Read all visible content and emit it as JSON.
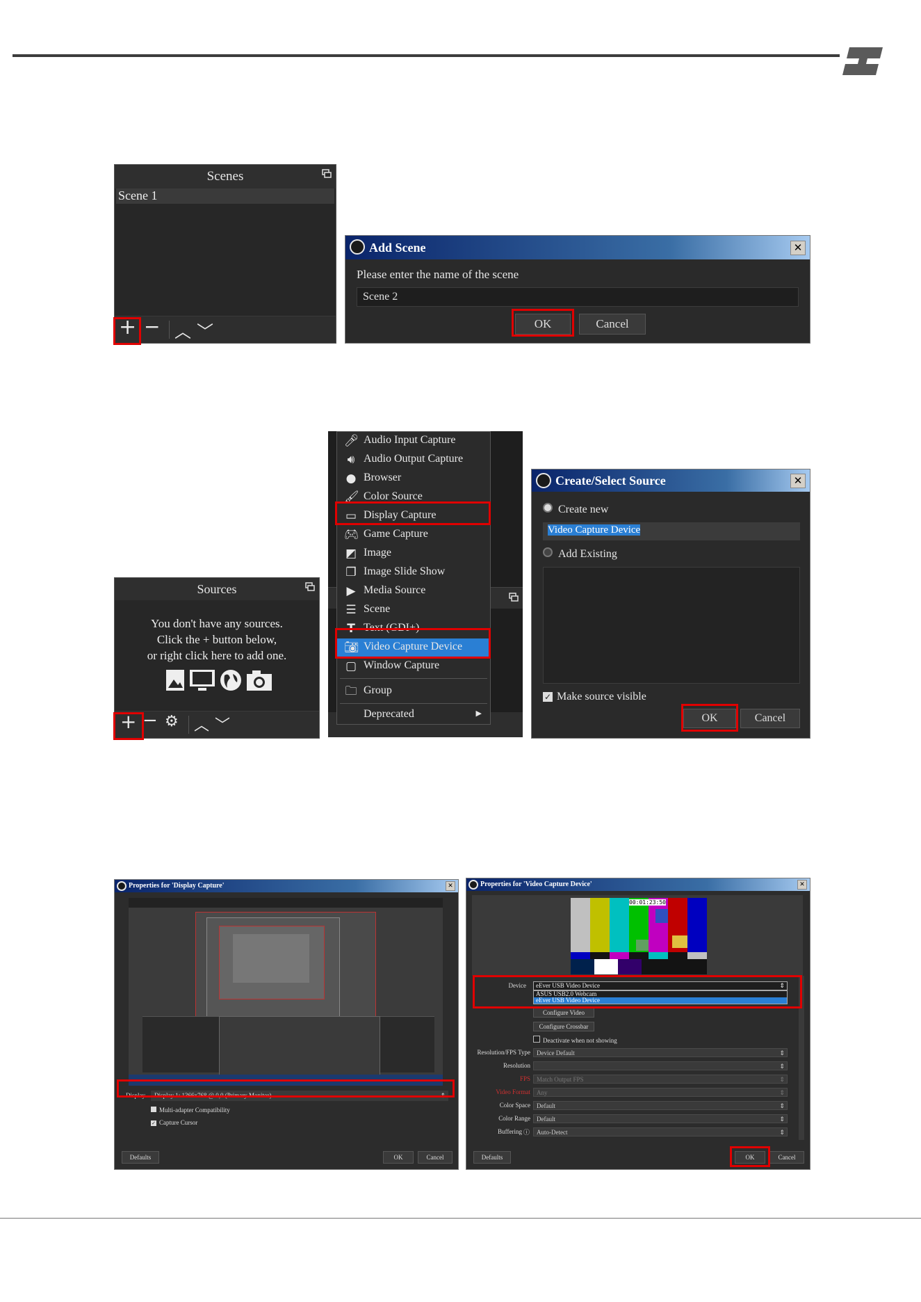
{
  "scenes_panel": {
    "title": "Scenes",
    "items": [
      "Scene 1"
    ]
  },
  "add_scene_dialog": {
    "title": "Add Scene",
    "prompt": "Please enter the name of the scene",
    "input_value": "Scene 2",
    "ok": "OK",
    "cancel": "Cancel"
  },
  "sources_panel": {
    "title": "Sources",
    "empty_line1": "You don't have any sources.",
    "empty_line2": "Click the + button below,",
    "empty_line3": "or right click here to add one."
  },
  "source_menu": {
    "items": [
      {
        "label": "Audio Input Capture",
        "icon": "microphone-icon"
      },
      {
        "label": "Audio Output Capture",
        "icon": "speaker-icon"
      },
      {
        "label": "Browser",
        "icon": "globe-icon"
      },
      {
        "label": "Color Source",
        "icon": "paintbrush-icon"
      },
      {
        "label": "Display Capture",
        "icon": "monitor-icon"
      },
      {
        "label": "Game Capture",
        "icon": "gamepad-icon"
      },
      {
        "label": "Image",
        "icon": "image-icon"
      },
      {
        "label": "Image Slide Show",
        "icon": "slideshow-icon"
      },
      {
        "label": "Media Source",
        "icon": "play-icon"
      },
      {
        "label": "Scene",
        "icon": "list-icon"
      },
      {
        "label": "Text (GDI+)",
        "icon": "text-icon"
      },
      {
        "label": "Video Capture Device",
        "icon": "camera-icon"
      },
      {
        "label": "Window Capture",
        "icon": "window-icon"
      },
      {
        "label": "Group",
        "icon": "folder-icon"
      },
      {
        "label": "Deprecated",
        "icon": "submenu-arrow-icon"
      }
    ]
  },
  "create_source_dialog": {
    "title": "Create/Select Source",
    "create_new": "Create new",
    "name_value": "Video Capture Device",
    "add_existing": "Add Existing",
    "make_visible": "Make source visible",
    "ok": "OK",
    "cancel": "Cancel"
  },
  "display_props": {
    "title": "Properties for 'Display Capture'",
    "display_label": "Display",
    "display_value": "Display 1: 1366x768 @ 0,0 (Primary Monitor)",
    "multi_adapter": "Multi-adapter Compatibility",
    "capture_cursor": "Capture Cursor",
    "defaults": "Defaults",
    "ok": "OK",
    "cancel": "Cancel"
  },
  "video_props": {
    "title": "Properties for 'Video Capture Device'",
    "timecode": "00:01:23:50",
    "device_label": "Device",
    "device_value": "eEver USB Video Device",
    "device_options": [
      "ASUS USB2.0 Webcam",
      "eEver USB Video Device"
    ],
    "configure_video": "Configure Video",
    "configure_crossbar": "Configure Crossbar",
    "deactivate": "Deactivate when not showing",
    "rows": [
      {
        "label": "Resolution/FPS Type",
        "value": "Device Default",
        "red": false
      },
      {
        "label": "Resolution",
        "value": "",
        "red": false
      },
      {
        "label": "FPS",
        "value": "Match Output FPS",
        "red": true
      },
      {
        "label": "Video Format",
        "value": "Any",
        "red": true
      },
      {
        "label": "Color Space",
        "value": "Default",
        "red": false
      },
      {
        "label": "Color Range",
        "value": "Default",
        "red": false
      },
      {
        "label": "Buffering",
        "value": "Auto-Detect",
        "red": false
      }
    ],
    "defaults": "Defaults",
    "ok": "OK",
    "cancel": "Cancel"
  },
  "colors": {
    "highlight_red": "#e00000",
    "selection_blue": "#2a7fd4",
    "titlebar_blue": "#0a246a",
    "panel_dark": "#272727"
  }
}
